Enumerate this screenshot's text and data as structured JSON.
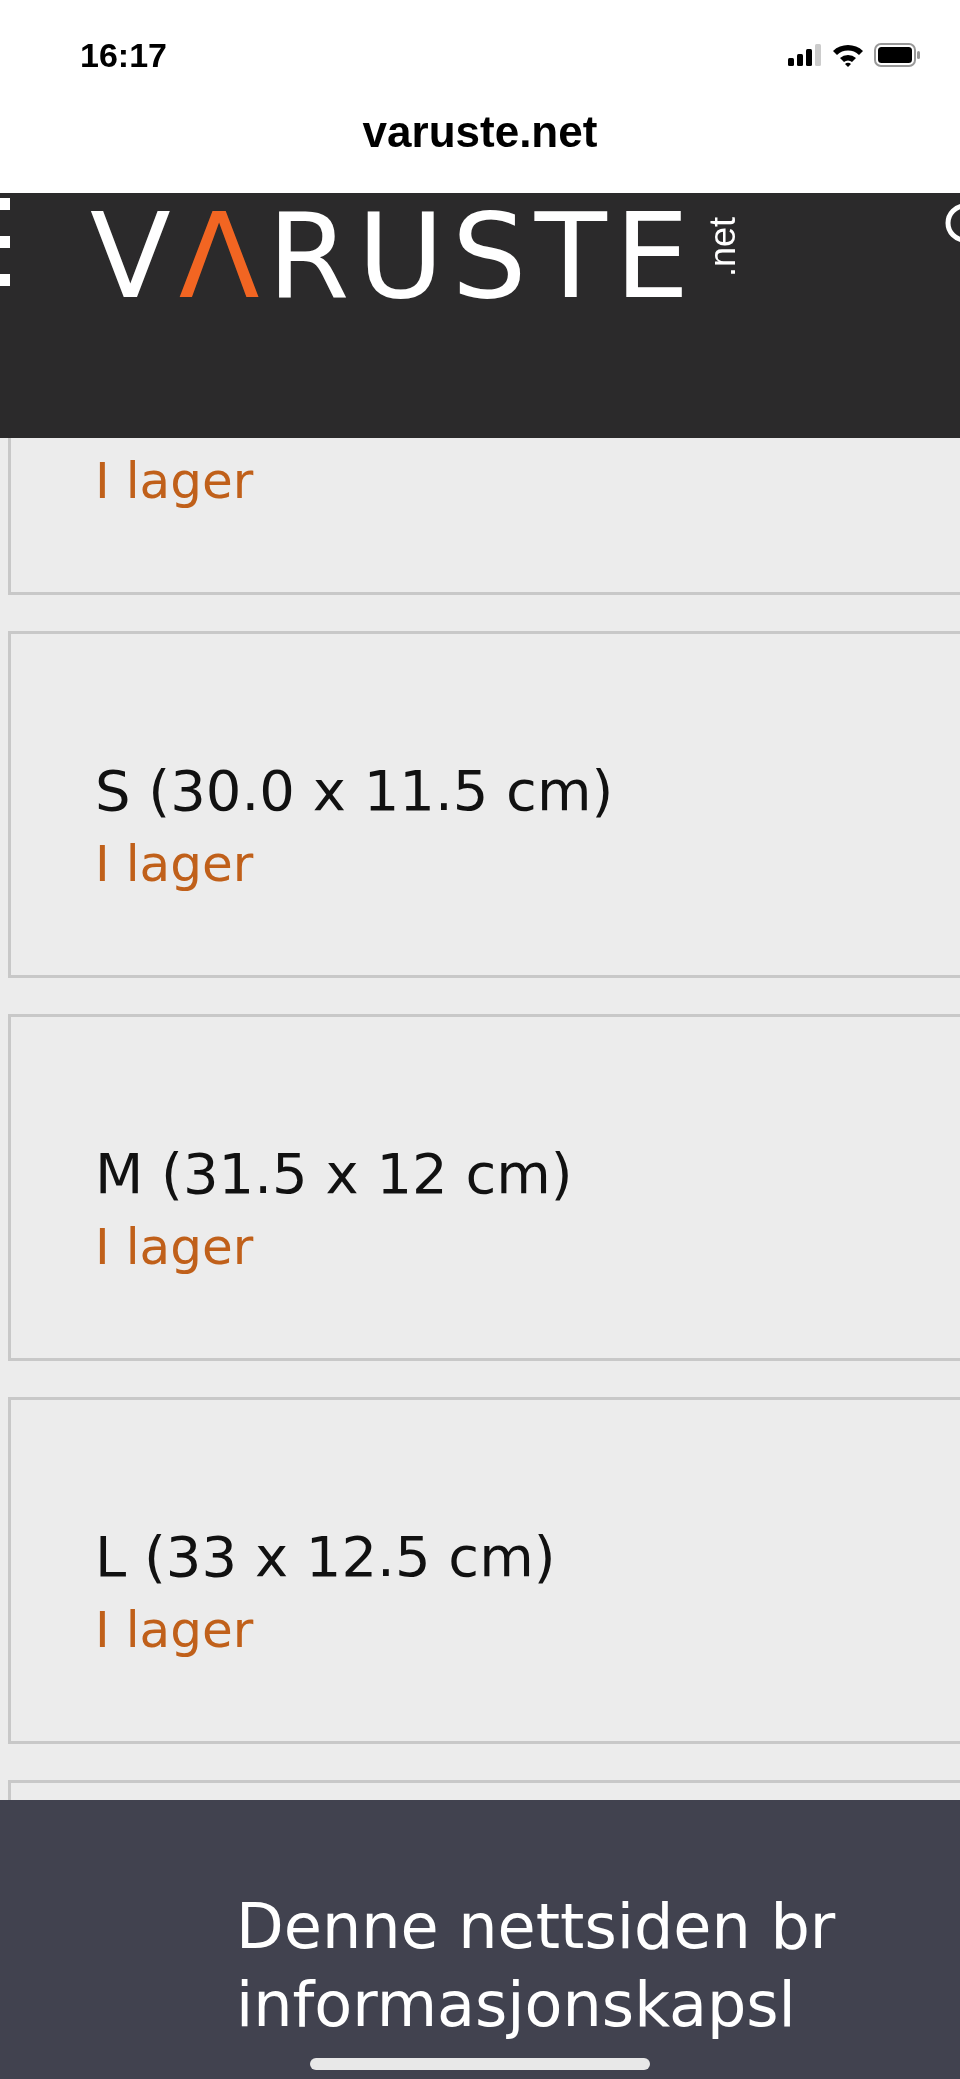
{
  "status_bar": {
    "time": "16:17"
  },
  "address_bar": {
    "url": "varuste.net"
  },
  "header": {
    "logo": [
      {
        "text": "V",
        "accent": false
      },
      {
        "text": "Λ",
        "accent": true
      },
      {
        "text": "RUSTE",
        "accent": false
      }
    ],
    "logo_suffix": ".net"
  },
  "variants": [
    {
      "stock": "I lager"
    },
    {
      "name": "S (30.0 x 11.5 cm)",
      "stock": "I lager"
    },
    {
      "name": "M (31.5 x 12 cm)",
      "stock": "I lager"
    },
    {
      "name": "L (33 x 12.5 cm)",
      "stock": "I lager"
    }
  ],
  "cookie_banner": {
    "lines": [
      "Denne nettsiden br",
      "informasjonskapsl"
    ]
  }
}
